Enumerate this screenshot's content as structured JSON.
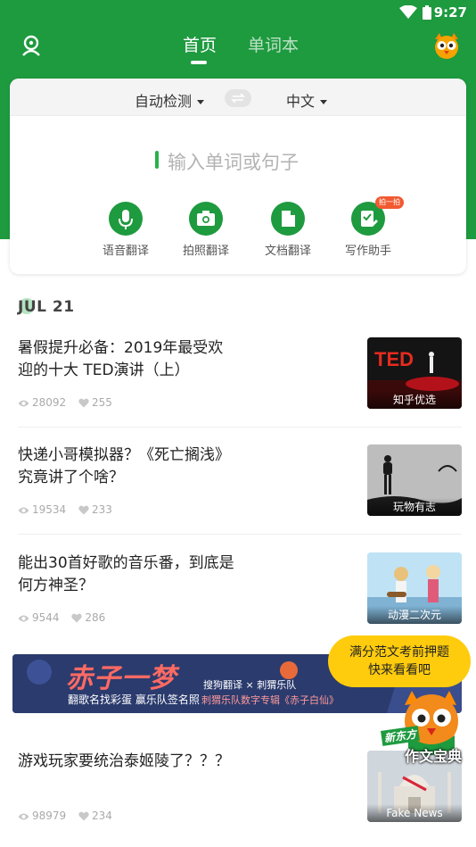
{
  "status_bar": {
    "time": "9:27"
  },
  "nav": {
    "tabs": [
      {
        "label": "首页",
        "active": true
      },
      {
        "label": "单词本",
        "active": false
      }
    ]
  },
  "translate": {
    "source_lang": "自动检测",
    "target_lang": "中文",
    "input_placeholder": "输入单词或句子",
    "tools": [
      {
        "label": "语音翻译",
        "icon": "microphone-icon"
      },
      {
        "label": "拍照翻译",
        "icon": "camera-icon"
      },
      {
        "label": "文档翻译",
        "icon": "document-icon"
      },
      {
        "label": "写作助手",
        "icon": "writing-assistant-icon",
        "badge": "拍一拍"
      }
    ]
  },
  "feed": {
    "date": "JUL 21",
    "articles": [
      {
        "title": "暑假提升必备：2019年最受欢迎的十大 TED演讲（上）",
        "views": "28092",
        "likes": "255",
        "thumb_caption": "知乎优选",
        "thumb_text": "TED"
      },
      {
        "title": "快递小哥模拟器？《死亡搁浅》究竟讲了个啥？",
        "views": "19534",
        "likes": "233",
        "thumb_caption": "玩物有志"
      },
      {
        "title": "能出30首好歌的音乐番，到底是何方神圣？",
        "views": "9544",
        "likes": "286",
        "thumb_caption": "动漫二次元"
      },
      {
        "title": "游戏玩家要统治泰姬陵了？？？",
        "views": "98979",
        "likes": "234",
        "thumb_caption": "Fake News"
      }
    ]
  },
  "ad_banner": {
    "headline": "赤子一梦",
    "sub_left": "翻歌名找彩蛋 赢乐队签名照",
    "brand_line": "搜狗翻译 × 刺猬乐队",
    "sub_right": "刺猬乐队数字专辑《赤子白仙》"
  },
  "promo": {
    "bubble_line1": "满分范文考前押题",
    "bubble_line2": "快来看看吧",
    "tag1": "新东方",
    "tag2": "作文宝典"
  },
  "colors": {
    "brand_green": "#1e9a3f",
    "badge_orange": "#f25a31",
    "bubble_yellow": "#ffcc0d"
  }
}
